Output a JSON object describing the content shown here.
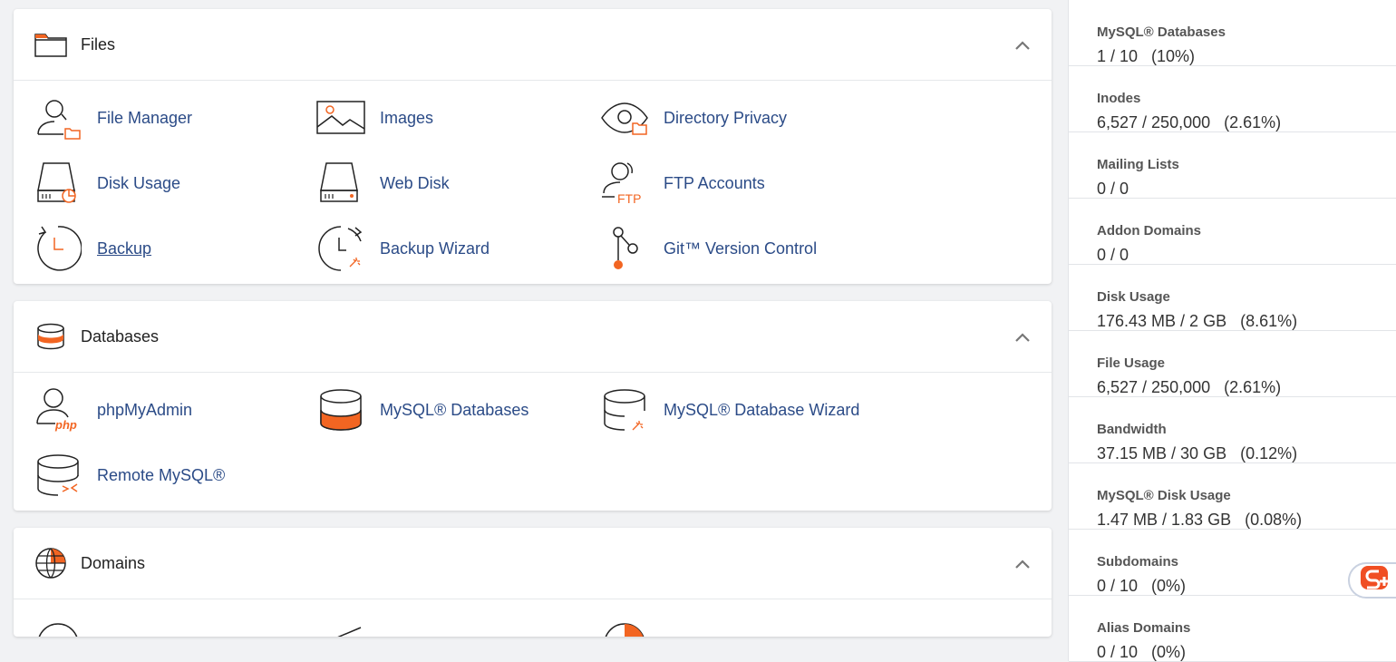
{
  "colors": {
    "accent": "#f26522",
    "link": "#2b4b87",
    "icon_stroke": "#222222"
  },
  "sections": [
    {
      "title": "Files",
      "icon": "folder-icon",
      "items": [
        {
          "label": "File Manager",
          "icon": "file-manager-icon"
        },
        {
          "label": "Images",
          "icon": "images-icon"
        },
        {
          "label": "Directory Privacy",
          "icon": "directory-privacy-icon"
        },
        {
          "label": "Disk Usage",
          "icon": "disk-usage-icon"
        },
        {
          "label": "Web Disk",
          "icon": "web-disk-icon"
        },
        {
          "label": "FTP Accounts",
          "icon": "ftp-accounts-icon",
          "icon_text": "FTP"
        },
        {
          "label": "Backup",
          "icon": "backup-icon"
        },
        {
          "label": "Backup Wizard",
          "icon": "backup-wizard-icon"
        },
        {
          "label": "Git™ Version Control",
          "icon": "git-icon"
        }
      ]
    },
    {
      "title": "Databases",
      "icon": "database-icon",
      "items": [
        {
          "label": "phpMyAdmin",
          "icon": "phpmyadmin-icon",
          "icon_text": "php"
        },
        {
          "label": "MySQL® Databases",
          "icon": "mysql-databases-icon"
        },
        {
          "label": "MySQL® Database Wizard",
          "icon": "mysql-wizard-icon"
        },
        {
          "label": "Remote MySQL®",
          "icon": "remote-mysql-icon"
        }
      ]
    },
    {
      "title": "Domains",
      "icon": "globe-icon"
    }
  ],
  "stats": [
    {
      "label": "MySQL® Databases",
      "value": "1 / 10   (10%)"
    },
    {
      "label": "Inodes",
      "value": "6,527 / 250,000   (2.61%)"
    },
    {
      "label": "Mailing Lists",
      "value": "0 / 0"
    },
    {
      "label": "Addon Domains",
      "value": "0 / 0"
    },
    {
      "label": "Disk Usage",
      "value": "176.43 MB / 2 GB   (8.61%)"
    },
    {
      "label": "File Usage",
      "value": "6,527 / 250,000   (2.61%)"
    },
    {
      "label": "Bandwidth",
      "value": "37.15 MB / 30 GB   (0.12%)"
    },
    {
      "label": "MySQL® Disk Usage",
      "value": "1.47 MB / 1.83 GB   (0.08%)"
    },
    {
      "label": "Subdomains",
      "value": "0 / 10   (0%)"
    },
    {
      "label": "Alias Domains",
      "value": "0 / 10   (0%)"
    }
  ]
}
